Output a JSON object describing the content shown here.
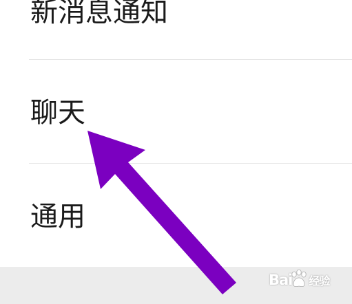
{
  "settings": {
    "items": [
      {
        "label": "新消息通知"
      },
      {
        "label": "聊天"
      },
      {
        "label": "通用"
      }
    ]
  },
  "watermark": {
    "brand": "Bai",
    "suffix": "经验"
  },
  "annotation": {
    "arrow_color": "#7b00c0",
    "target": "聊天"
  }
}
